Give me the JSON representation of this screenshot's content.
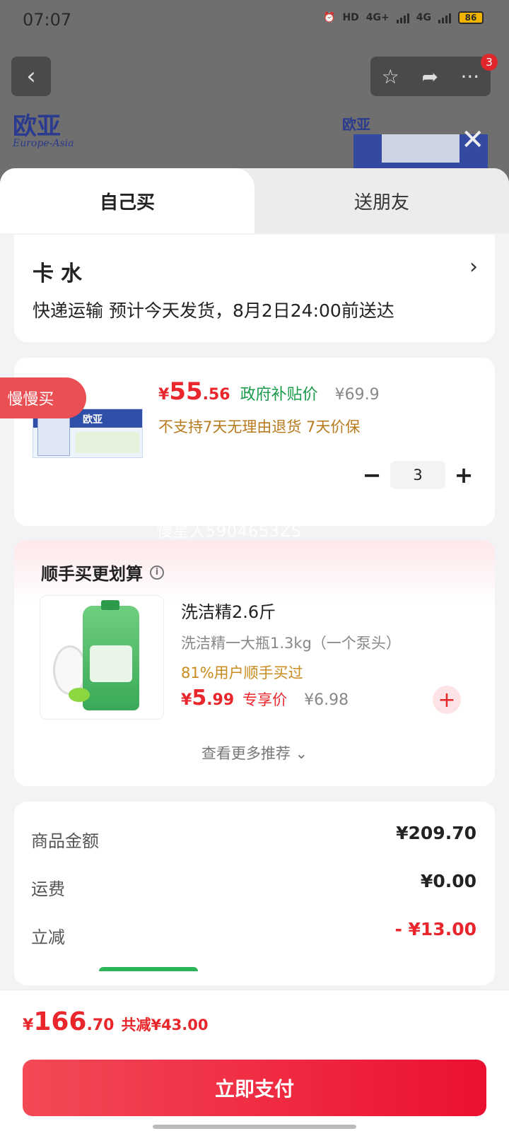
{
  "status": {
    "time": "07:07",
    "hd": "HD",
    "net1": "4G+",
    "net2": "4G",
    "battery": "86"
  },
  "bg": {
    "back_icon": "back-arrow-icon",
    "badge": "3",
    "logo_main": "欧亚",
    "logo_sub": "Europe-Asia",
    "logo_small": "欧亚"
  },
  "tabs": {
    "self": "自己买",
    "gift": "送朋友"
  },
  "address": {
    "name": "卡水",
    "shipping": "快递运输 预计今天发货，8月2日24:00前送达"
  },
  "product": {
    "image_text": "欧亚",
    "currency": "¥",
    "price_int": "55",
    "price_dec": ".56",
    "subsidy_label": "政府补贴价",
    "original_price": "¥69.9",
    "policy": "不支持7天无理由退货 7天价保",
    "quantity": "3",
    "slow_buy_label": "慢慢买"
  },
  "watermark": "慢星人5904653ZS",
  "recommend": {
    "title": "顺手买更划算",
    "item": {
      "name": "洗洁精2.6斤",
      "desc": "洗洁精一大瓶1.3kg（一个泵头）",
      "stat": "81%用户顺手买过",
      "currency": "¥",
      "price_int": "5",
      "price_dec": ".99",
      "exclusive_label": "专享价",
      "original_price": "¥6.98"
    },
    "more": "查看更多推荐"
  },
  "summary": {
    "goods_label": "商品金额",
    "goods_value": "¥209.70",
    "shipping_label": "运费",
    "shipping_value": "¥0.00",
    "discount_label": "立减",
    "discount_value": "- ¥13.00"
  },
  "footer": {
    "currency": "¥",
    "total_int": "166",
    "total_dec": ".70",
    "saved": "共减¥43.00",
    "pay_label": "立即支付"
  },
  "colors": {
    "accent": "#e8262b",
    "subsidy": "#1a9a4a",
    "policy": "#b87a1e"
  }
}
